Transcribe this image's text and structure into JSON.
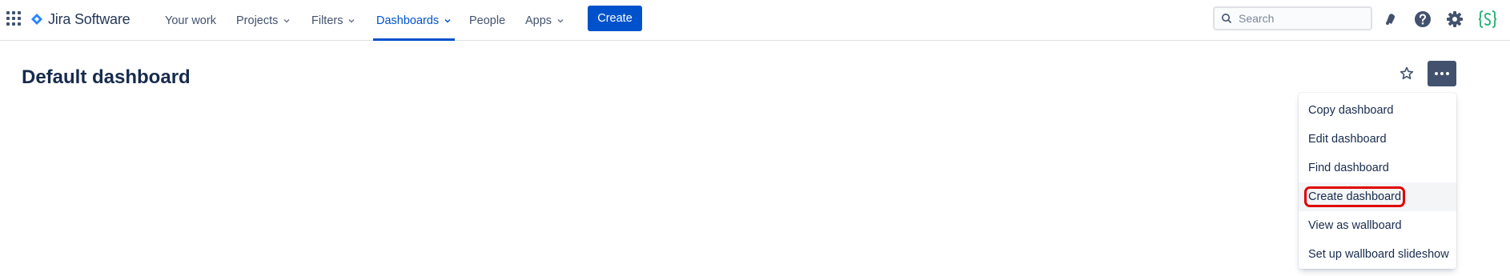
{
  "app": {
    "name": "Jira Software",
    "brand_color": "#0052cc"
  },
  "nav": {
    "items": [
      {
        "label": "Your work",
        "has_dropdown": false,
        "active": false
      },
      {
        "label": "Projects",
        "has_dropdown": true,
        "active": false
      },
      {
        "label": "Filters",
        "has_dropdown": true,
        "active": false
      },
      {
        "label": "Dashboards",
        "has_dropdown": true,
        "active": true
      },
      {
        "label": "People",
        "has_dropdown": false,
        "active": false
      },
      {
        "label": "Apps",
        "has_dropdown": true,
        "active": false
      }
    ],
    "create_label": "Create"
  },
  "search": {
    "placeholder": "Search"
  },
  "icons": {
    "app_switcher": "grid-icon",
    "notifications": "bell-icon",
    "help": "help-icon",
    "settings": "gear-icon",
    "profile": "script-runner-icon",
    "star": "star-icon",
    "more": "more-icon"
  },
  "page": {
    "title": "Default dashboard"
  },
  "menu": {
    "items": [
      {
        "label": "Copy dashboard",
        "highlighted": false
      },
      {
        "label": "Edit dashboard",
        "highlighted": false
      },
      {
        "label": "Find dashboard",
        "highlighted": false
      },
      {
        "label": "Create dashboard",
        "highlighted": true
      },
      {
        "label": "View as wallboard",
        "highlighted": false
      },
      {
        "label": "Set up wallboard slideshow",
        "highlighted": false
      }
    ]
  }
}
